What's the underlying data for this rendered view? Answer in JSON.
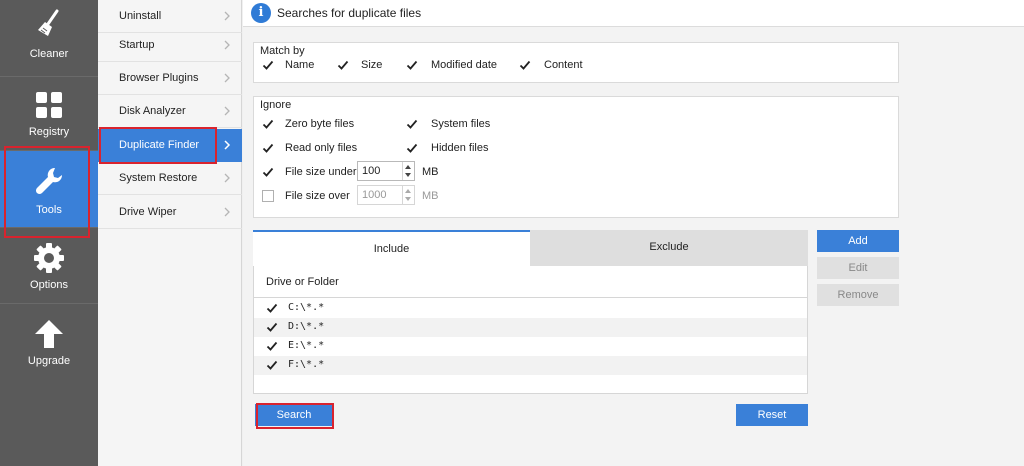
{
  "nav": {
    "items": [
      {
        "label": "Cleaner",
        "icon": "broom-icon"
      },
      {
        "label": "Registry",
        "icon": "grid-icon"
      },
      {
        "label": "Tools",
        "icon": "wrench-icon"
      },
      {
        "label": "Options",
        "icon": "gear-icon"
      },
      {
        "label": "Upgrade",
        "icon": "arrow-up-icon"
      }
    ],
    "active": "Tools"
  },
  "subnav": {
    "items": [
      "Uninstall",
      "Startup",
      "Browser Plugins",
      "Disk Analyzer",
      "Duplicate Finder",
      "System Restore",
      "Drive Wiper"
    ],
    "active": "Duplicate Finder"
  },
  "title": "Searches for duplicate files",
  "match_by": {
    "title": "Match by",
    "options": [
      {
        "label": "Name",
        "checked": true
      },
      {
        "label": "Size",
        "checked": true
      },
      {
        "label": "Modified date",
        "checked": true
      },
      {
        "label": "Content",
        "checked": true
      }
    ]
  },
  "ignore": {
    "title": "Ignore",
    "zero_byte": {
      "label": "Zero byte files",
      "checked": true
    },
    "system": {
      "label": "System files",
      "checked": true
    },
    "read_only": {
      "label": "Read only files",
      "checked": true
    },
    "hidden": {
      "label": "Hidden files",
      "checked": true
    },
    "size_under": {
      "label": "File size under",
      "checked": true,
      "value": "100",
      "unit": "MB"
    },
    "size_over": {
      "label": "File size over",
      "checked": false,
      "value": "1000",
      "unit": "MB"
    }
  },
  "tabs": {
    "include": "Include",
    "exclude": "Exclude",
    "active": "Include"
  },
  "list": {
    "header": "Drive or Folder",
    "rows": [
      {
        "path": "C:\\*.*",
        "checked": true
      },
      {
        "path": "D:\\*.*",
        "checked": true
      },
      {
        "path": "E:\\*.*",
        "checked": true
      },
      {
        "path": "F:\\*.*",
        "checked": true
      }
    ]
  },
  "buttons": {
    "add": "Add",
    "edit": "Edit",
    "remove": "Remove",
    "search": "Search",
    "reset": "Reset"
  },
  "colors": {
    "accent": "#3a80d8",
    "nav_bg": "#5a5a5a",
    "highlight": "#d9232e"
  }
}
